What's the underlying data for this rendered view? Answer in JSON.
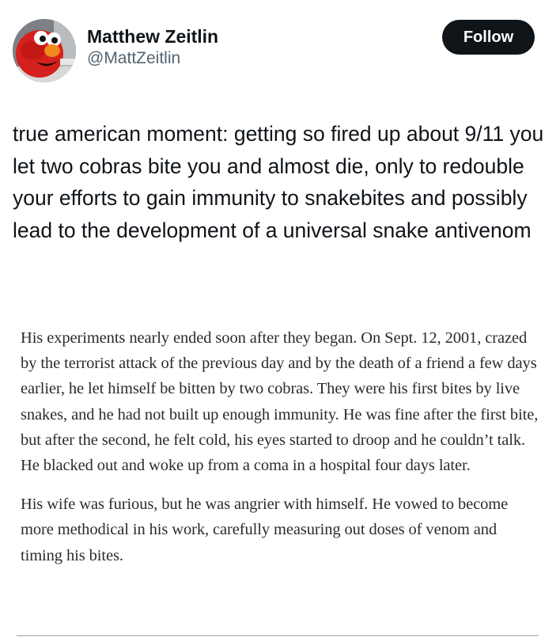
{
  "tweet": {
    "author": {
      "display_name": "Matthew Zeitlin",
      "handle": "@MattZeitlin",
      "avatar_icon": "elmo-avatar-icon"
    },
    "follow_label": "Follow",
    "text": "true american moment: getting so fired up about 9/11 you let two cobras bite you and almost die, only to redouble your efforts to gain immunity to snakebites and possibly lead to the development of a universal snake antivenom"
  },
  "article": {
    "paragraphs": [
      "His experiments nearly ended soon after they began. On Sept. 12, 2001, crazed by the terrorist attack of the previous day and by the death of a friend a few days earlier, he let himself be bitten by two cobras. They were his first bites by live snakes, and he had not built up enough immunity. He was fine after the first bite, but after the second, he felt cold, his eyes started to droop and he couldn’t talk. He blacked out and woke up from a coma in a hospital four days later.",
      "His wife was furious, but he was angrier with himself. He vowed to become more methodical in his work, carefully measuring out doses of venom and timing his bites."
    ]
  },
  "colors": {
    "text": "#0f1419",
    "handle": "#536471",
    "follow_bg": "#0f1419",
    "follow_text": "#ffffff",
    "article_text": "#2b2b2b"
  }
}
